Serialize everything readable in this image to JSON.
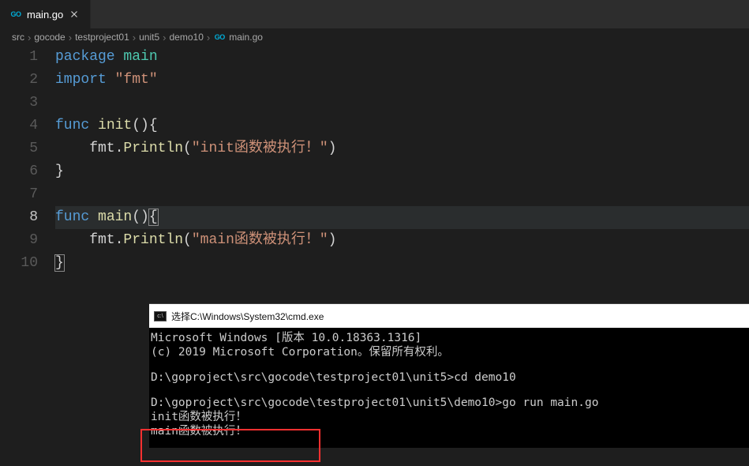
{
  "tab": {
    "label": "main.go",
    "close": "✕"
  },
  "breadcrumb": [
    "src",
    "gocode",
    "testproject01",
    "unit5",
    "demo10",
    "main.go"
  ],
  "gutter": [
    "1",
    "2",
    "3",
    "4",
    "5",
    "6",
    "7",
    "8",
    "9",
    "10"
  ],
  "code": {
    "l1": {
      "a": "package",
      "b": " main"
    },
    "l2": {
      "a": "import",
      "b": " \"fmt\""
    },
    "l4": {
      "a": "func",
      "b": " ",
      "c": "init",
      "d": "(){"
    },
    "l5": {
      "a": "    fmt.",
      "b": "Println",
      "c": "(",
      "d": "\"init函数被执行！\"",
      "e": ")"
    },
    "l6": "}",
    "l8": {
      "a": "func",
      "b": " ",
      "c": "main",
      "d": "()",
      "e": "{"
    },
    "l9": {
      "a": "    fmt.",
      "b": "Println",
      "c": "(",
      "d": "\"main函数被执行！\"",
      "e": ")"
    },
    "l10": "}"
  },
  "cmd": {
    "title": "选择C:\\Windows\\System32\\cmd.exe",
    "lines": [
      "Microsoft Windows [版本 10.0.18363.1316]",
      "(c) 2019 Microsoft Corporation。保留所有权利。",
      "",
      "D:\\goproject\\src\\gocode\\testproject01\\unit5>cd demo10",
      "",
      "D:\\goproject\\src\\gocode\\testproject01\\unit5\\demo10>go run main.go",
      "init函数被执行！",
      "main函数被执行！"
    ]
  },
  "go_label": "GO"
}
